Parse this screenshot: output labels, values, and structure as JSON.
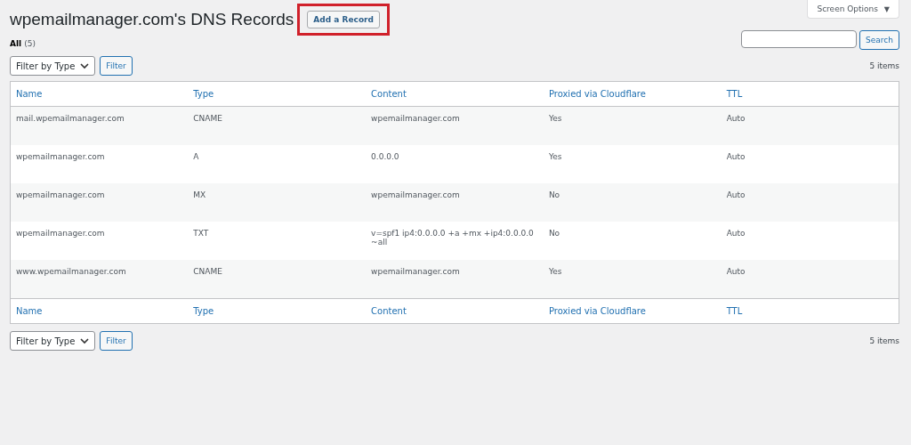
{
  "page_title": "wpemailmanager.com's DNS Records",
  "add_button": {
    "label": "Add a Record",
    "highlighted": true
  },
  "screen_options": {
    "label": "Screen Options",
    "caret": "▼"
  },
  "views": [
    {
      "label": "All",
      "count": "(5)",
      "selected": true
    }
  ],
  "search": {
    "button": "Search"
  },
  "top_nav": {
    "filter_select": "Filter by Type",
    "filter_button": "Filter",
    "items_count": "5 items"
  },
  "table": {
    "columns": [
      "Name",
      "Type",
      "Content",
      "Proxied via Cloudflare",
      "TTL"
    ],
    "rows": [
      [
        "mail.wpemailmanager.com",
        "CNAME",
        "wpemailmanager.com",
        "Yes",
        "Auto"
      ],
      [
        "wpemailmanager.com",
        "A",
        "0.0.0.0",
        "Yes",
        "Auto"
      ],
      [
        "wpemailmanager.com",
        "MX",
        "wpemailmanager.com",
        "No",
        "Auto"
      ],
      [
        "wpemailmanager.com",
        "TXT",
        "v=spf1 ip4:0.0.0.0 +a +mx +ip4:0.0.0.0 ~all",
        "No",
        "Auto"
      ],
      [
        "www.wpemailmanager.com",
        "CNAME",
        "wpemailmanager.com",
        "Yes",
        "Auto"
      ]
    ],
    "footer_columns": [
      "Name",
      "Type",
      "Content",
      "Proxied via Cloudflare",
      "TTL"
    ]
  },
  "bottom_nav": {
    "filter_select": "Filter by Type",
    "filter_button": "Filter",
    "items_count": "5 items"
  }
}
